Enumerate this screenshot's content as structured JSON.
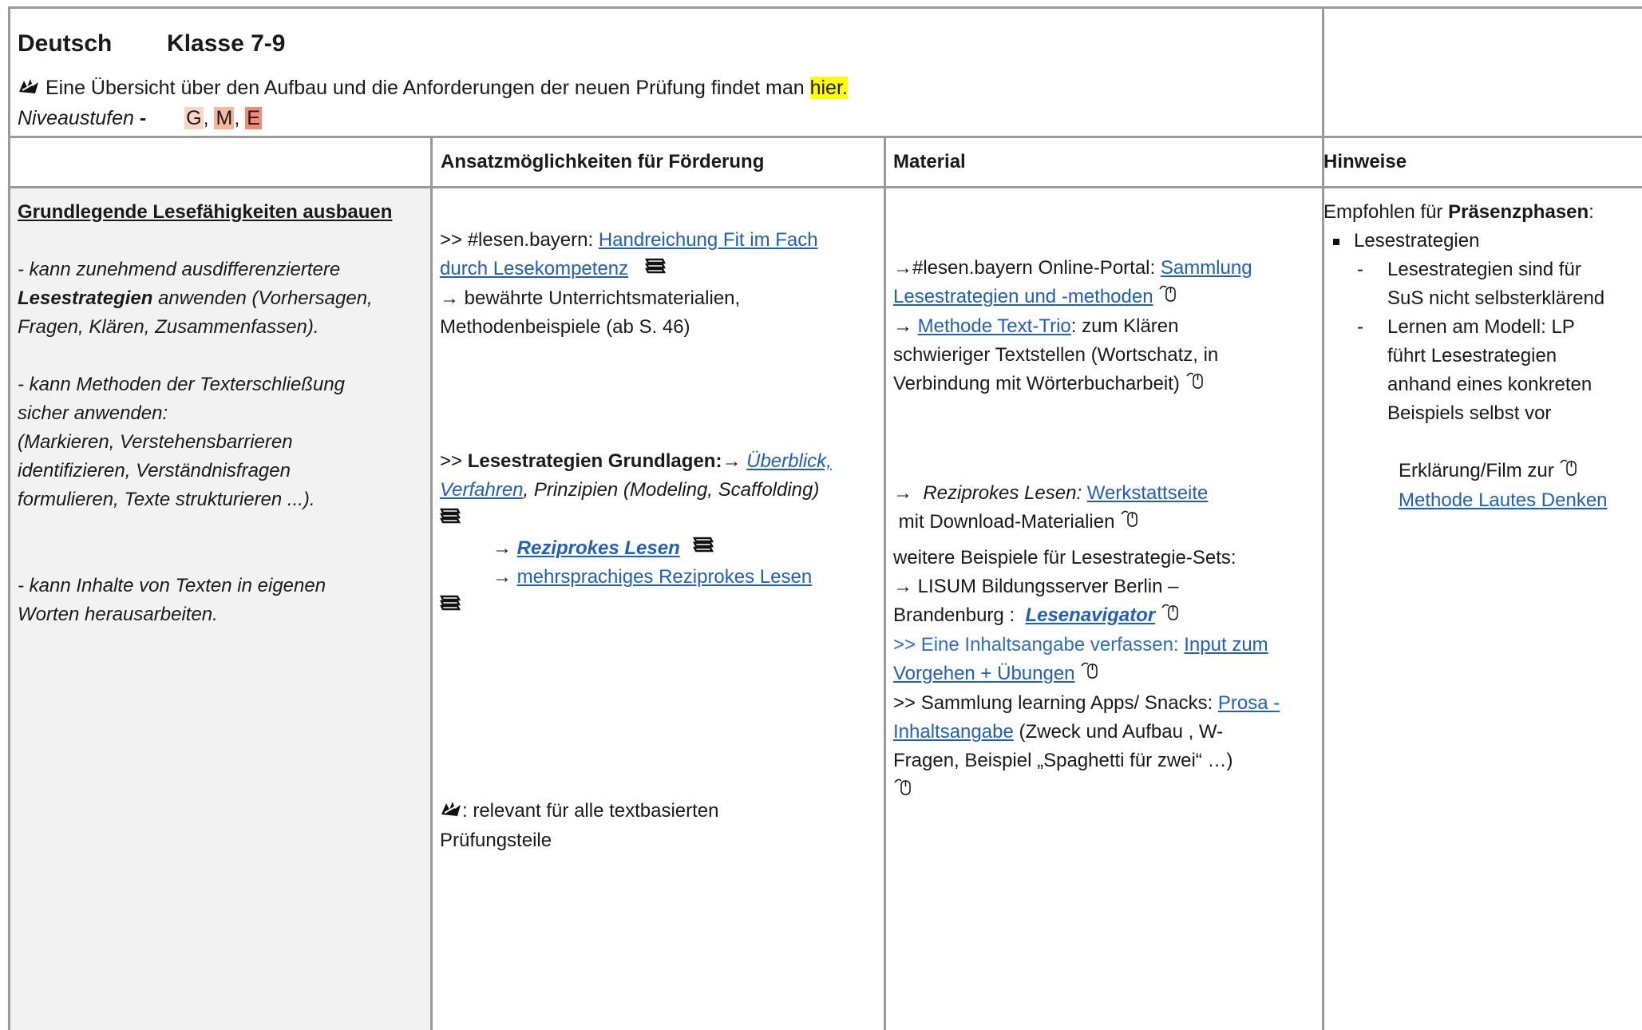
{
  "title": {
    "subject": "Deutsch",
    "grade": "Klasse 7-9"
  },
  "intro": {
    "text": "Eine Übersicht über den Aufbau und die Anforderungen der neuen Prüfung findet man",
    "link": "hier."
  },
  "niveau": {
    "label": "Niveaustufen",
    "dash": "-",
    "levels": [
      "G",
      "M",
      "E"
    ],
    "colors": [
      "#fbd5c2",
      "#f7b79b",
      "#f28b74"
    ]
  },
  "columns": {
    "ansatz": "Ansatzmöglichkeiten für Förderung",
    "material": "Material",
    "hinweise": "Hinweise"
  },
  "left": {
    "heading": "Grundlegende Lesefähigkeiten ausbauen",
    "p1a": "- kann zunehmend ausdifferenziertere",
    "p1b": "Lesestrategien",
    "p1c": "anwenden (Vorhersagen,",
    "p1d": "Fragen, Klären, Zusammenfassen).",
    "p2a": "- kann Methoden der Texterschließung",
    "p2b": "sicher anwenden:",
    "p2c": "(Markieren, Verstehensbarrieren",
    "p2d": "identifizieren, Verständnisfragen",
    "p2e": "formulieren, Texte strukturieren ...).",
    "p3a": "- kann Inhalte von Texten in eigenen",
    "p3b": "Worten herausarbeiten."
  },
  "ansatz": {
    "l1pre": ">> #lesen.bayern:",
    "l1link_a": "Handreichung Fit im Fach",
    "l1link_b": "durch Lesekompetenz",
    "l2": "→ bewährte Unterrichtsmaterialien,",
    "l3": "Methodenbeispiele (ab S. 46)",
    "l4pre": ">>",
    "l4bold": "Lesestrategien Grundlagen:",
    "l4arrow": "→",
    "l4link": "Überblick,",
    "l5link": "Verfahren",
    "l5rest": ", Prinzipien (Modeling, Scaffolding)",
    "l6arrow": "→",
    "l6link": "Reziprokes Lesen",
    "l7arrow": "→",
    "l7link": "mehrsprachiges Reziprokes Lesen",
    "l8": ": relevant für alle textbasierten",
    "l9": "Prüfungsteile"
  },
  "material": {
    "m1pre": "→#lesen.bayern Online-Portal:",
    "m1link_a": "Sammlung",
    "m1link_b": "Lesestrategien und -methoden",
    "m2arrow": "→",
    "m2link": "Methode Text-Trio",
    "m2rest": ": zum Klären",
    "m3": "schwieriger Textstellen (Wortschatz, in",
    "m4": "Verbindung mit Wörterbucharbeit)",
    "m5arrow": "→",
    "m5it": "Reziprokes Lesen:",
    "m5link": "Werkstattseite",
    "m6": "mit Download-Materialien",
    "m7": "weitere Beispiele für Lesestrategie-Sets:",
    "m8": "→     LISUM Bildungsserver Berlin –",
    "m9pre": "Brandenburg :",
    "m9link": "Lesenavigator",
    "m10pre": ">> Eine Inhaltsangabe verfassen:",
    "m10link_a": "Input zum",
    "m10link_b": "Vorgehen + Übungen",
    "m11pre": ">> Sammlung learning Apps/ Snacks:",
    "m11link_a": "Prosa -",
    "m11link_b": "Inhaltsangabe",
    "m11rest": "(Zweck und Aufbau , W-",
    "m12": "Fragen, Beispiel „Spaghetti für zwei“ …)"
  },
  "hinweise": {
    "h1pre": "Empfohlen für",
    "h1bold": "Präsenzphasen",
    "h1post": ":",
    "bullet": "Lesestrategien",
    "d1a": "Lesestrategien sind für",
    "d1b": "SuS nicht selbsterklärend",
    "d2a": "Lernen am Modell: LP",
    "d2b": "führt Lesestrategien",
    "d2c": "anhand eines konkreten",
    "d2d": "Beispiels selbst vor",
    "e1": "Erklärung/Film zur",
    "e2link": "Methode Lautes Denken"
  }
}
